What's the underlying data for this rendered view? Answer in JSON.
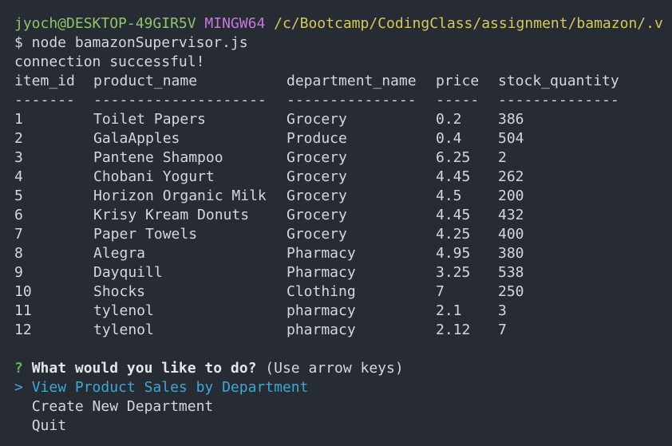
{
  "prompt": {
    "user_host": "jyoch@DESKTOP-49GIR5V",
    "system": "MINGW64",
    "path": "/c/Bootcamp/CodingClass/assignment/bamazon/.v"
  },
  "command": "$ node bamazonSupervisor.js",
  "status": "connection successful!",
  "table": {
    "headers": [
      "item_id",
      "product_name",
      "department_name",
      "price",
      "stock_quantity"
    ],
    "separators": [
      "-------",
      "--------------------",
      "---------------",
      "-----",
      "--------------"
    ],
    "rows": [
      [
        "1",
        "Toilet Papers",
        "Grocery",
        "0.2",
        "386"
      ],
      [
        "2",
        "GalaApples",
        "Produce",
        "0.4",
        "504"
      ],
      [
        "3",
        "Pantene Shampoo",
        "Grocery",
        "6.25",
        "2"
      ],
      [
        "4",
        "Chobani Yogurt",
        "Grocery",
        "4.45",
        "262"
      ],
      [
        "5",
        "Horizon Organic Milk",
        "Grocery",
        "4.5",
        "200"
      ],
      [
        "6",
        "Krisy Kream Donuts",
        "Grocery",
        "4.45",
        "432"
      ],
      [
        "7",
        "Paper Towels",
        "Grocery",
        "4.25",
        "400"
      ],
      [
        "8",
        "Alegra",
        "Pharmacy",
        "4.95",
        "380"
      ],
      [
        "9",
        "Dayquill",
        "Pharmacy",
        "3.25",
        "538"
      ],
      [
        "10",
        "Shocks",
        "Clothing",
        "7",
        "250"
      ],
      [
        "11",
        "tylenol",
        "pharmacy",
        "2.1",
        "3"
      ],
      [
        "12",
        "tylenol",
        "pharmacy",
        "2.12",
        "7"
      ]
    ]
  },
  "question": {
    "mark": "?",
    "text": "What would you like to do?",
    "hint": "(Use arrow keys)"
  },
  "choices": {
    "pointer": ">",
    "selected": "View Product Sales by Department",
    "items": [
      "Create New Department",
      "Quit"
    ]
  },
  "colors": {
    "background": "#272b33",
    "user_host": "#8fc36d",
    "system": "#c678dd",
    "path": "#d6c85a",
    "selected_choice": "#3fa7d6",
    "question_mark": "#5fb65a"
  }
}
